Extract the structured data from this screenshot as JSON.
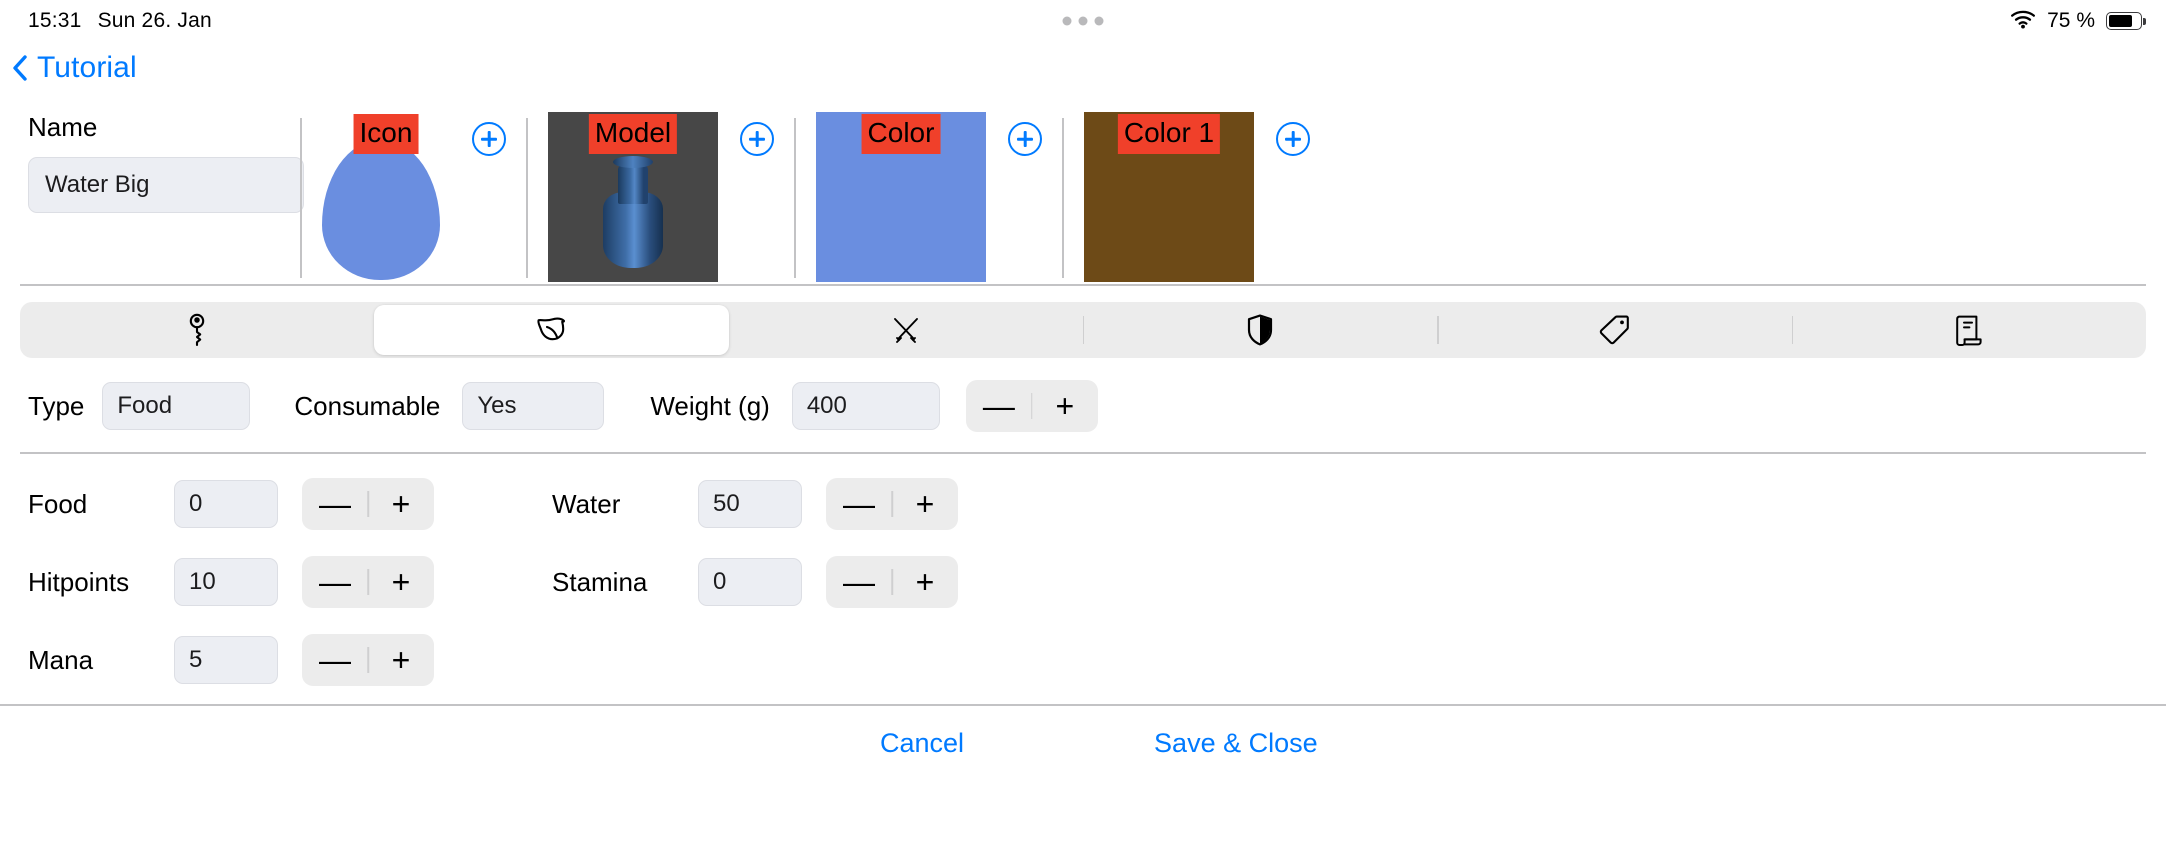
{
  "status_bar": {
    "time": "15:31",
    "date": "Sun 26. Jan",
    "battery_percent": "75 %",
    "wifi_icon": "wifi-icon",
    "battery_icon": "battery-icon"
  },
  "nav": {
    "back_label": "Tutorial",
    "back_icon": "chevron-left-icon"
  },
  "asset_row": {
    "name_label": "Name",
    "name_value": "Water Big",
    "name_placeholder": "Name",
    "items": [
      {
        "tag": "Icon",
        "add_icon": "plus-circle-icon",
        "kind": "icon-drop",
        "color": "#6a8ee0"
      },
      {
        "tag": "Model",
        "add_icon": "plus-circle-icon",
        "kind": "model-preview",
        "color": "#474747"
      },
      {
        "tag": "Color",
        "add_icon": "plus-circle-icon",
        "kind": "color-swatch",
        "color": "#6a8ee0"
      },
      {
        "tag": "Color 1",
        "add_icon": "plus-circle-icon",
        "kind": "color-swatch",
        "color": "#6d4a17"
      }
    ],
    "tag_highlight_color": "#f0402a"
  },
  "tabs": [
    {
      "name": "tab-key",
      "icon": "key-icon",
      "active": false
    },
    {
      "name": "tab-food",
      "icon": "leaf-icon",
      "active": true
    },
    {
      "name": "tab-weapon",
      "icon": "crossed-swords-icon",
      "active": false
    },
    {
      "name": "tab-armor",
      "icon": "shield-icon",
      "active": false
    },
    {
      "name": "tab-tag",
      "icon": "tag-icon",
      "active": false
    },
    {
      "name": "tab-document",
      "icon": "scroll-icon",
      "active": false
    }
  ],
  "type_row": {
    "type_label": "Type",
    "type_value": "Food",
    "consumable_label": "Consumable",
    "consumable_value": "Yes",
    "weight_label": "Weight (g)",
    "weight_value": "400",
    "minus_label": "—",
    "plus_label": "+"
  },
  "stats": {
    "minus_label": "—",
    "plus_label": "+",
    "left": [
      {
        "label": "Food",
        "value": "0"
      },
      {
        "label": "Hitpoints",
        "value": "10"
      },
      {
        "label": "Mana",
        "value": "5"
      }
    ],
    "right": [
      {
        "label": "Water",
        "value": "50"
      },
      {
        "label": "Stamina",
        "value": "0"
      }
    ]
  },
  "footer": {
    "cancel_label": "Cancel",
    "save_label": "Save & Close"
  },
  "colors": {
    "accent_blue": "#007aff",
    "tag_red": "#f0402a",
    "field_bg": "#eceef3",
    "segment_bg": "#ececec",
    "divider": "#c3c3c5"
  }
}
